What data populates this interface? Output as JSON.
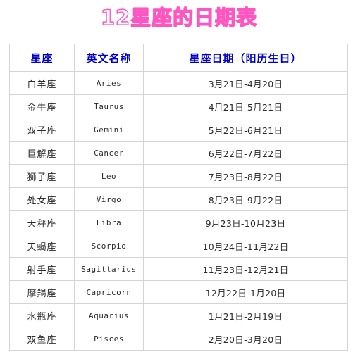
{
  "page": {
    "title": "12星座的日期表",
    "title_color": "#ff55c0",
    "background_color": "#ffffff"
  },
  "table": {
    "header_color": "#0000cc",
    "body_color": "#2b2b2b",
    "border_color": "#d5d5d5",
    "columns": [
      "星座",
      "英文名称",
      "星座日期（阳历生日）"
    ],
    "rows": [
      {
        "sign": "白羊座",
        "english": "Aries",
        "dates": "3月21日-4月20日"
      },
      {
        "sign": "金牛座",
        "english": "Taurus",
        "dates": "4月21日-5月21日"
      },
      {
        "sign": "双子座",
        "english": "Gemini",
        "dates": "5月22日-6月21日"
      },
      {
        "sign": "巨解座",
        "english": "Cancer",
        "dates": "6月22日-7月22日"
      },
      {
        "sign": "狮子座",
        "english": "Leo",
        "dates": "7月23日-8月22日"
      },
      {
        "sign": "处女座",
        "english": "Virgo",
        "dates": "8月23日-9月22日"
      },
      {
        "sign": "天秤座",
        "english": "Libra",
        "dates": "9月23日-10月23日"
      },
      {
        "sign": "天蝎座",
        "english": "Scorpio",
        "dates": "10月24日-11月22日"
      },
      {
        "sign": "射手座",
        "english": "Sagittarius",
        "dates": "11月23日-12月21日"
      },
      {
        "sign": "摩羯座",
        "english": "Capricorn",
        "dates": "12月22日-1月20日"
      },
      {
        "sign": "水瓶座",
        "english": "Aquarius",
        "dates": "1月21日-2月19日"
      },
      {
        "sign": "双鱼座",
        "english": "Pisces",
        "dates": "2月20日-3月20日"
      }
    ]
  }
}
